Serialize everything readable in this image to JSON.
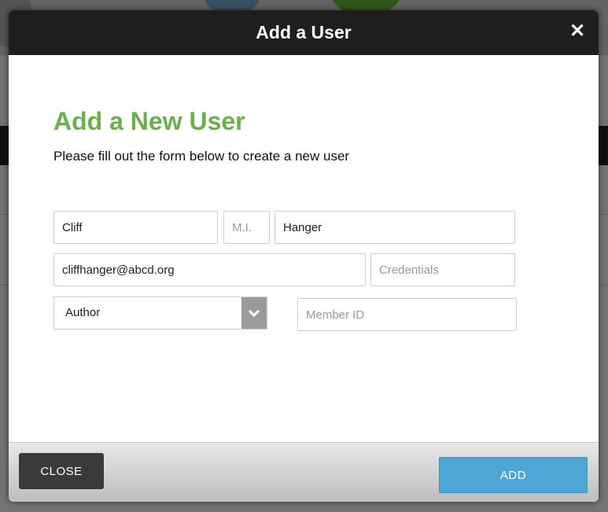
{
  "modal": {
    "title": "Add a User",
    "close_icon": "close-icon"
  },
  "form": {
    "heading": "Add a New User",
    "subtitle": "Please fill out the form below to create a new user",
    "first_name": {
      "value": "Cliff",
      "placeholder": ""
    },
    "middle_initial": {
      "value": "",
      "placeholder": "M.I."
    },
    "last_name": {
      "value": "Hanger",
      "placeholder": ""
    },
    "email": {
      "value": "cliffhanger@abcd.org",
      "placeholder": ""
    },
    "credentials": {
      "value": "",
      "placeholder": "Credentials"
    },
    "role": {
      "selected": "Author",
      "icon": "chevron-down-icon"
    },
    "member_id": {
      "value": "",
      "placeholder": "Member ID"
    }
  },
  "footer": {
    "close_label": "CLOSE",
    "add_label": "ADD"
  },
  "colors": {
    "heading": "#6ab04c",
    "header_bg": "#1e1e1e",
    "add_button": "#4ea6d4",
    "close_button": "#3a3a3a"
  }
}
